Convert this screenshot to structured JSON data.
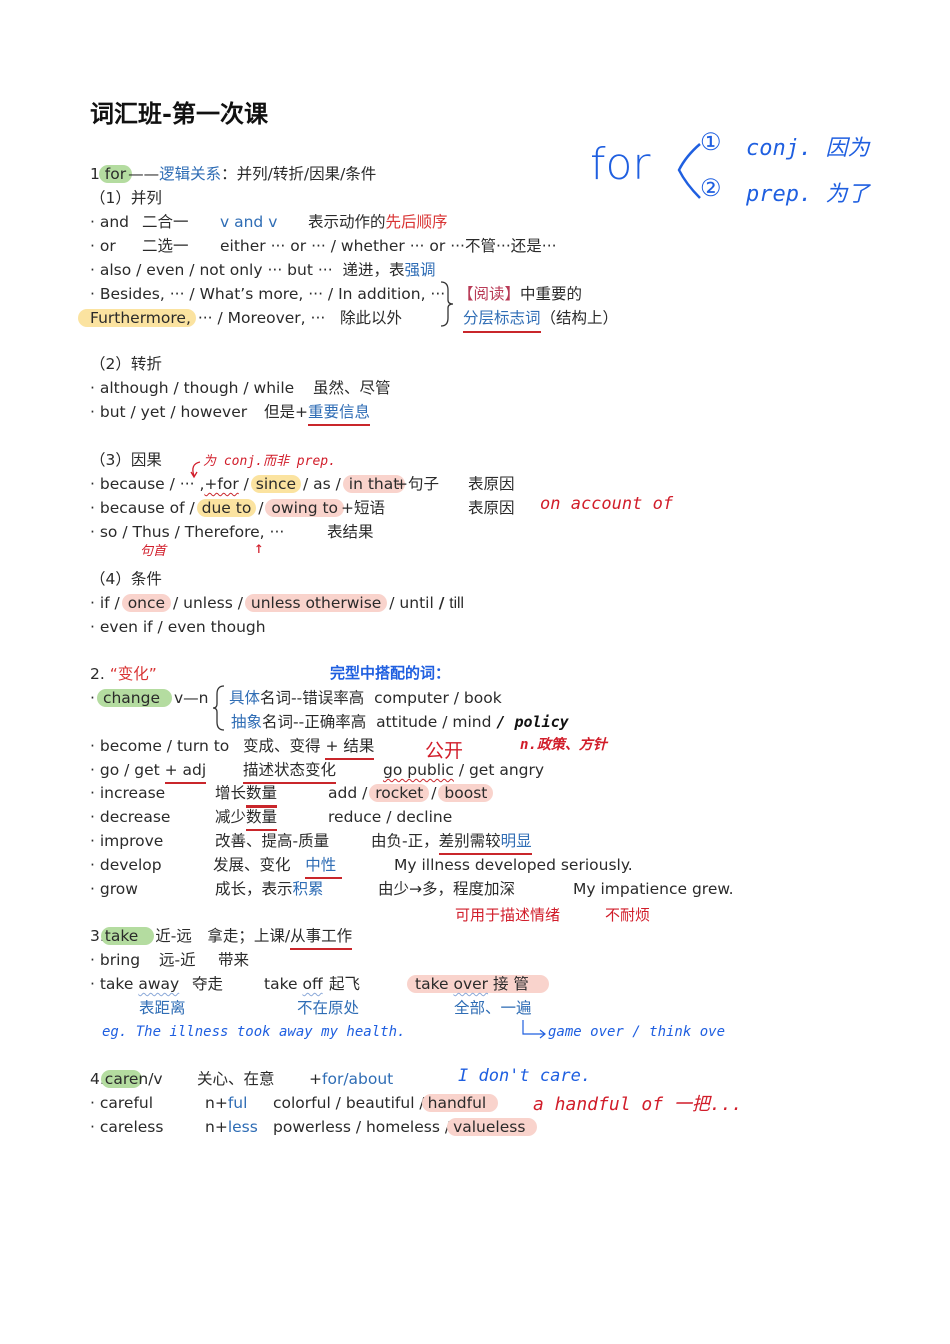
{
  "title": "词汇班-第一次课",
  "s1": {
    "num": "1.",
    "word": "for",
    "dash": "——",
    "label": "逻辑关系",
    "colon": "：",
    "types": "并列/转折/因果/条件",
    "annotation": {
      "word": "for",
      "item1_num": "①",
      "item1": "conj. 因为",
      "item2_num": "②",
      "item2": "prep. 为了"
    },
    "sub1": {
      "heading": "（1）并列",
      "and": {
        "word": "· and",
        "meaning": "二合一",
        "pattern": "v and v",
        "note": "表示动作的",
        "note_hl": "先后顺序"
      },
      "or": {
        "word": "· or",
        "meaning": "二选一",
        "pattern": "either ··· or ··· / whether ··· or ···",
        "note": "不管···还是···"
      },
      "also": {
        "text": "· also / even / not only ··· but ···",
        "note": "递进，表",
        "note_hl": "强调"
      },
      "besides": {
        "text": "· Besides, ··· / What’s more, ··· / In addition, ···"
      },
      "furthermore": {
        "hl": "Furthermore,",
        "text": "··· / Moreover, ···",
        "meaning": "除此以外"
      },
      "reading_note": {
        "bracket": "【阅读】",
        "text": "中重要的"
      },
      "marker_note": {
        "hl": "分层标志词",
        "text": "（结构上）"
      }
    },
    "sub2": {
      "heading": "（2）转折",
      "although": {
        "text": "· although / though / while",
        "meaning": "虽然、尽管"
      },
      "but": {
        "text": "· but / yet / however",
        "meaning": "但是+",
        "meaning_hl": "重要信息"
      }
    },
    "sub3": {
      "heading": "（3）因果",
      "handnote": "为 conj.而非 prep.",
      "because": {
        "pre": "· because / ··· ,",
        "for": "+for",
        "slash1": " / ",
        "since": "since",
        "mid": " / as / ",
        "in_that": "in that",
        "suffix": "+句子",
        "meaning": "表原因"
      },
      "because_of": {
        "pre": "· because of / ",
        "due_to": "due to",
        "slash": " / ",
        "owing_to": "owing to",
        "suffix": "+短语",
        "meaning": "表原因",
        "handnote": "on   account  of"
      },
      "so": {
        "text": "· so / Thus / Therefore, ···",
        "meaning": "表结果",
        "handnote_left": "句首",
        "arrow": "↑"
      }
    },
    "sub4": {
      "heading": "（4）条件",
      "if": {
        "pre": "· if / ",
        "once": "once",
        "mid": " / unless / ",
        "otherwise": "unless otherwise",
        "post": " / until ",
        "slash": "/",
        "till": "till"
      },
      "even": {
        "text": "· even if / even though"
      }
    }
  },
  "s2": {
    "num": "2.",
    "label": "“变化”",
    "handnote": "完型中搭配的词：",
    "change": {
      "bullet": "·",
      "word": "change",
      "vn": "v—n",
      "concrete": {
        "hl": "具体",
        "text": "名词--错误率高",
        "eg": "computer / book"
      },
      "abstract": {
        "hl": "抽象",
        "text": "名词--正确率高",
        "eg": "attitude / mind",
        "hand": "/ policy"
      }
    },
    "policy_note": "n.政策、方针",
    "public_note": "公开",
    "rows": [
      {
        "word": "· become / turn to",
        "meaning": "变成、变得 ",
        "meaning_ul": "+ 结果"
      },
      {
        "word": "· go / get ",
        "word_ul": "+ adj",
        "meaning_ul": "描述状态变化",
        "eg_wavy": "go public",
        "eg": " / get angry"
      },
      {
        "word": "· increase",
        "meaning": "增长",
        "meaning_ul": "数量",
        "eg_pre": "add / ",
        "eg_hl1": "rocket",
        "eg_mid": " / ",
        "eg_hl2": "boost"
      },
      {
        "word": "· decrease",
        "meaning": "减少",
        "meaning_ul": "数量",
        "eg": "reduce / decline"
      },
      {
        "word": "· improve",
        "meaning": "改善、提高-质量",
        "note": "由负-正，",
        "note_ul": "差别需较",
        "note_ul_blue": "明显"
      },
      {
        "word": "· develop",
        "meaning": "发展、变化",
        "meaning_blue_ul": "中性",
        "eg": "My illness developed seriously."
      },
      {
        "word": "· grow",
        "meaning": "成长，表示",
        "meaning_blue": "积累",
        "note": "由少→多，程度加深",
        "eg": "My impatience grew."
      }
    ],
    "grow_note1": "可用于描述情绪",
    "grow_note2": "不耐烦"
  },
  "s3": {
    "num": "3.",
    "word": "take",
    "meaning": "近-远　拿走；上课/",
    "meaning_ul": "从事工作",
    "bring": {
      "word": "· bring",
      "dir": "远-近",
      "meaning": "带来"
    },
    "phrases": {
      "away_pre": "· take ",
      "away": "away",
      "away_m": "夺走",
      "off_pre": "take ",
      "off": "off",
      "off_m": "起飞",
      "over_pre": "take ",
      "over": "over",
      "over_m": " 接 管"
    },
    "notes": {
      "away": "表距离",
      "off": "不在原处",
      "over": "全部、一遍"
    },
    "eg": "eg. The illness took away my health.",
    "game_over": "game  over  /  think  ove"
  },
  "s4": {
    "num": "4.",
    "word": "care",
    "pos": "n/v",
    "meaning": "关心、在意",
    "prep_plus": "+",
    "prep": "for/about",
    "hand": "I  don't  care.",
    "rows": [
      {
        "word": "· careful",
        "n": "n+",
        "suffix": "ful",
        "eg": "colorful / beautiful /",
        "eg_hl": "handful"
      },
      {
        "word": "· careless",
        "n": "n+",
        "suffix": "less",
        "eg": "powerless / homeless /",
        "eg_hl": "valueless"
      }
    ],
    "handful_note": "a  handful  of 一把..."
  }
}
